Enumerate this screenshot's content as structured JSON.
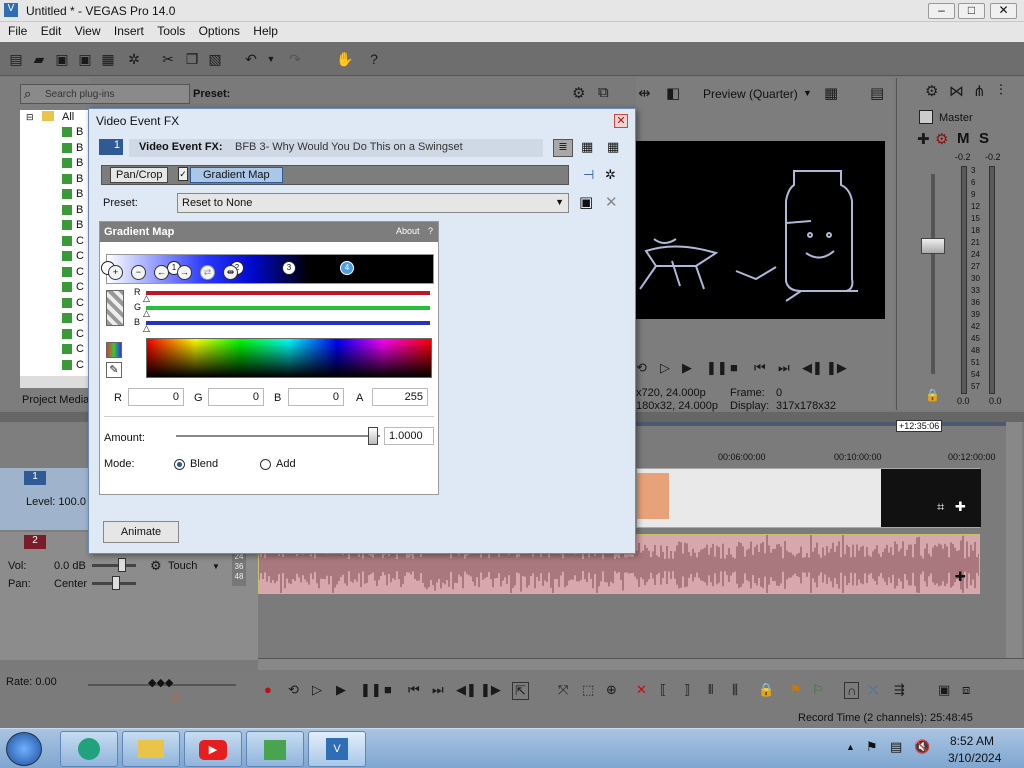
{
  "window": {
    "title": "Untitled * - VEGAS Pro 14.0",
    "min": "–",
    "max": "□",
    "close": "✕"
  },
  "menu": [
    "File",
    "Edit",
    "View",
    "Insert",
    "Tools",
    "Options",
    "Help"
  ],
  "plugins": {
    "search_placeholder": "Search plug-ins",
    "preset_label": "Preset:",
    "root_label": "All",
    "tab_label": "Project Media",
    "items": [
      "B",
      "B",
      "B",
      "B",
      "B",
      "B",
      "B",
      "C",
      "C",
      "C",
      "C",
      "C",
      "C",
      "C",
      "C",
      "C"
    ]
  },
  "preview": {
    "mode": "Preview (Quarter)",
    "info_left1": "x720, 24.000p",
    "info_left2": "180x32, 24.000p",
    "frame_label": "Frame:",
    "frame_value": "0",
    "display_label": "Display:",
    "display_value": "317x178x32"
  },
  "mixer": {
    "master_label": "Master",
    "m": "M",
    "s": "S",
    "db_left": "-0.2",
    "db_right": "-0.2",
    "scale": [
      "3",
      "6",
      "9",
      "12",
      "15",
      "18",
      "21",
      "24",
      "27",
      "30",
      "33",
      "36",
      "39",
      "42",
      "45",
      "48",
      "51",
      "54",
      "57"
    ],
    "bottom_left": "0.0",
    "bottom_right": "0.0"
  },
  "dialog": {
    "title": "Video Event FX",
    "track_num": "1",
    "fx_label": "Video Event FX:",
    "fx_name": "BFB 3- Why Would You Do This on a Swingset",
    "chain": [
      "Pan/Crop",
      "Gradient Map"
    ],
    "preset_label": "Preset:",
    "preset_value": "Reset to None",
    "plugin_title": "Gradient Map",
    "about": "About",
    "help": "?",
    "stops": [
      "1",
      "2",
      "3",
      "4"
    ],
    "rgb_labels": [
      "R",
      "G",
      "B"
    ],
    "field_labels": {
      "r": "R",
      "g": "G",
      "b": "B",
      "a": "A"
    },
    "field_values": {
      "r": "0",
      "g": "0",
      "b": "0",
      "a": "255"
    },
    "amount_label": "Amount:",
    "amount_value": "1.0000",
    "mode_label": "Mode:",
    "mode_blend": "Blend",
    "mode_add": "Add",
    "animate": "Animate"
  },
  "tracks": {
    "t1_num": "1",
    "level": "Level: 100.0",
    "t2_num": "2",
    "vol_label": "Vol:",
    "vol_value": "0.0 dB",
    "touch": "Touch",
    "pan_label": "Pan:",
    "pan_value": "Center",
    "meter": [
      "12",
      "24",
      "36",
      "48"
    ]
  },
  "timeline": {
    "marker": "+12:35:06",
    "ticks": [
      "00:06:00:00",
      "00:10:00:00",
      "00:12:00:00"
    ]
  },
  "status": {
    "rate": "Rate: 0.00",
    "record_time": "Record Time (2 channels): 25:48:45"
  },
  "taskbar": {
    "time": "8:52 AM",
    "date": "3/10/2024"
  },
  "colors": {
    "accent": "#2f6db5",
    "dialog_bg": "#dfe9f5",
    "audio": "#d8a7ad",
    "audio_wave": "#7a4a50"
  }
}
